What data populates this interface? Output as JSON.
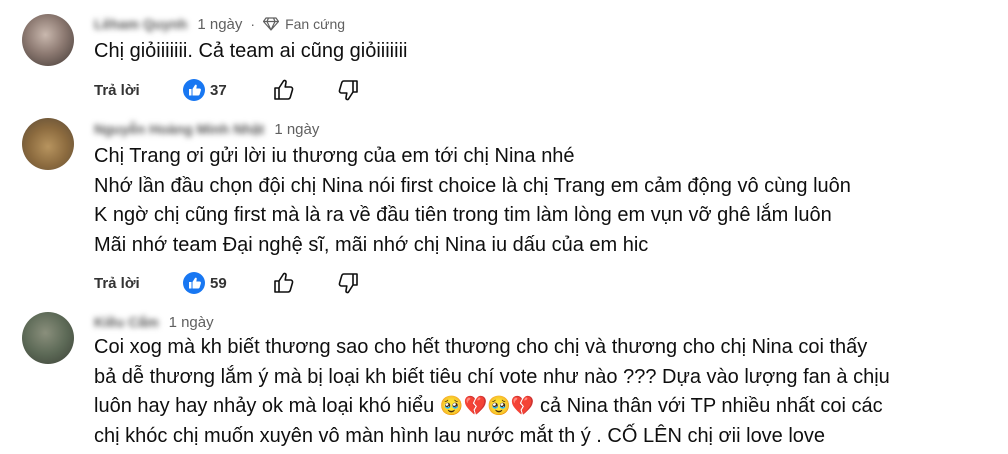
{
  "comments": [
    {
      "username": "Lêham Quynh",
      "time": "1 ngày",
      "badge": "Fan cứng",
      "lines": [
        "Chị giỏiiiiiii. Cả team ai cũng giỏiiiiiii"
      ],
      "reply_label": "Trả lời",
      "likes": "37"
    },
    {
      "username": "Nguyễn Hoàng Minh Nhật",
      "time": "1 ngày",
      "lines": [
        "Chị Trang ơi gửi lời iu thương của em tới chị Nina nhé",
        "Nhớ lần đầu chọn đội chị Nina nói first choice là chị Trang em cảm động vô cùng luôn",
        "K ngờ chị cũng first mà là ra về đầu tiên trong tim làm lòng em vụn vỡ ghê lắm luôn",
        "Mãi nhớ team Đại nghệ sĩ, mãi nhớ chị Nina iu dấu của em hic"
      ],
      "reply_label": "Trả lời",
      "likes": "59"
    },
    {
      "username": "Kiều Cẩm",
      "time": "1 ngày",
      "lines": [
        "Coi xog mà kh biết thương sao cho hết thương cho chị và thương cho chị Nina coi thấy",
        "bả dễ thương lắm ý mà bị loại kh biết tiêu chí vote như nào ??? Dựa vào lượng fan à chịu",
        "luôn hay hay nhảy ok mà loại khó hiểu",
        "cả Nina thân với TP nhiều nhất coi các",
        "chị khóc chị muốn xuyên vô màn hình lau nước mắt th ý . CỐ LÊN chị ơii love love"
      ],
      "emojis": [
        "🥹",
        "💔",
        "🥹",
        "💔"
      ]
    }
  ]
}
